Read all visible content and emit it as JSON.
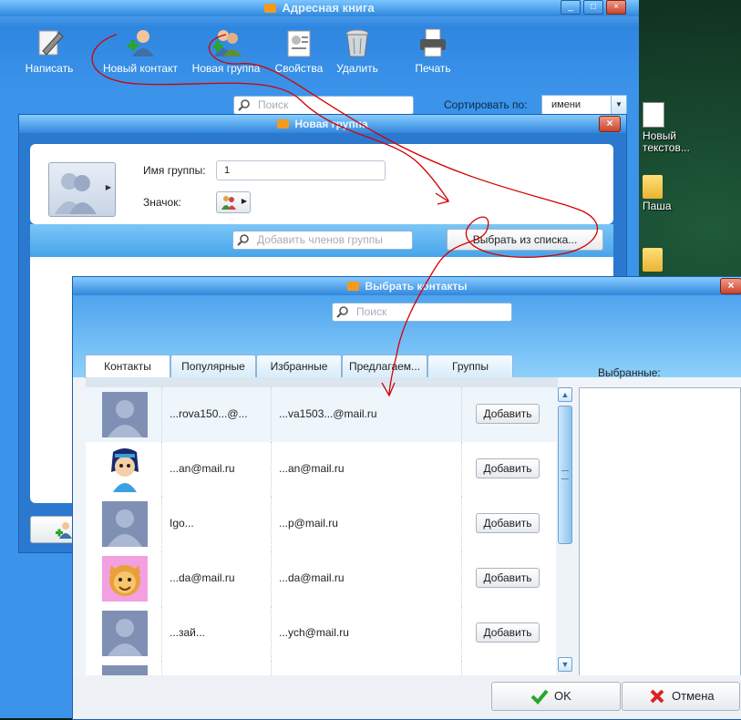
{
  "address_book": {
    "title": "Адресная книга",
    "toolbar": [
      {
        "label": "Написать",
        "icon": "pencil-icon"
      },
      {
        "label": "Новый контакт",
        "icon": "new-contact-icon"
      },
      {
        "label": "Новая группа",
        "icon": "new-group-icon"
      },
      {
        "label": "Свойства",
        "icon": "properties-icon"
      },
      {
        "label": "Удалить",
        "icon": "trash-icon"
      },
      {
        "label": "Печать",
        "icon": "printer-icon"
      }
    ],
    "search_placeholder": "Поиск",
    "sort_label": "Сортировать по:",
    "sort_value": "имени"
  },
  "desktop": {
    "icons": [
      {
        "label": "Новый\nтекстов..."
      },
      {
        "label": "Паша"
      },
      {
        "label": ""
      }
    ]
  },
  "new_group": {
    "title": "Новая группа",
    "name_label": "Имя группы:",
    "name_value": "1",
    "icon_label": "Значок:",
    "members_placeholder": "Добавить членов группы",
    "choose_button": "Выбрать из списка..."
  },
  "select_contacts": {
    "title": "Выбрать контакты",
    "search_placeholder": "Поиск",
    "tabs": [
      "Контакты",
      "Популярные",
      "Избранные",
      "Предлагаем...",
      "Группы"
    ],
    "selected_label": "Выбранные:",
    "add_label": "Добавить",
    "rows": [
      {
        "name": "...rova150...@...",
        "email": "...va1503...@mail.ru"
      },
      {
        "name": "...an@mail.ru",
        "email": "...an@mail.ru"
      },
      {
        "name": "Igo...",
        "email": "...p@mail.ru"
      },
      {
        "name": "...da@mail.ru",
        "email": "...da@mail.ru"
      },
      {
        "name": "...зай...",
        "email": "...ych@mail.ru"
      },
      {
        "name": "",
        "email": ""
      }
    ],
    "ok_label": "OK",
    "cancel_label": "Отмена"
  },
  "colors": {
    "window_blue": "#2f86e0",
    "title_gradient_top": "#86ccff",
    "close_red": "#c9442d",
    "annotation_red": "#d40000"
  }
}
